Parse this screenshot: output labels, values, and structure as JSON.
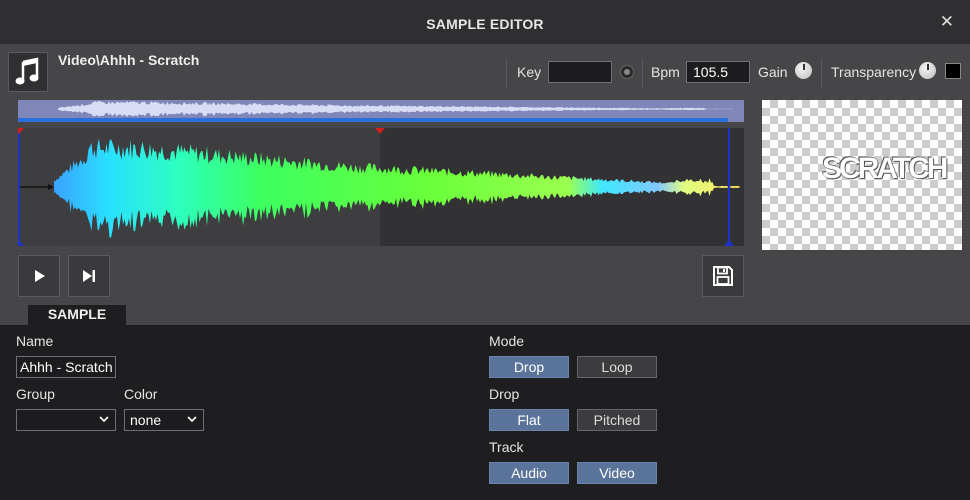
{
  "window": {
    "title": "SAMPLE EDITOR"
  },
  "header": {
    "file_name": "Video\\Ahhh - Scratch",
    "key_label": "Key",
    "key_value": "",
    "bpm_label": "Bpm",
    "bpm_value": "105.5",
    "gain_label": "Gain",
    "transparency_label": "Transparency"
  },
  "preview": {
    "logo_text": "SCRATCH"
  },
  "tabs": [
    {
      "label": "SAMPLE",
      "active": true
    }
  ],
  "sample": {
    "name_label": "Name",
    "name_value": "Ahhh - Scratch",
    "group_label": "Group",
    "group_value": "",
    "color_label": "Color",
    "color_value": "none"
  },
  "mode": {
    "mode_label": "Mode",
    "mode_options": [
      {
        "label": "Drop",
        "active": true
      },
      {
        "label": "Loop",
        "active": false
      }
    ],
    "drop_label": "Drop",
    "drop_options": [
      {
        "label": "Flat",
        "active": true
      },
      {
        "label": "Pitched",
        "active": false
      }
    ],
    "track_label": "Track",
    "track_options": [
      {
        "label": "Audio",
        "active": true
      },
      {
        "label": "Video",
        "active": true
      }
    ]
  },
  "colors": {
    "accent": "#5a739a",
    "background": "#1e1e20",
    "panel": "#464649",
    "cue_marker": "#d02020",
    "end_marker": "#2030d0"
  },
  "icons": [
    "music-note-icon",
    "close-icon",
    "play-icon",
    "skip-to-end-icon",
    "save-icon",
    "chevron-down-icon"
  ]
}
